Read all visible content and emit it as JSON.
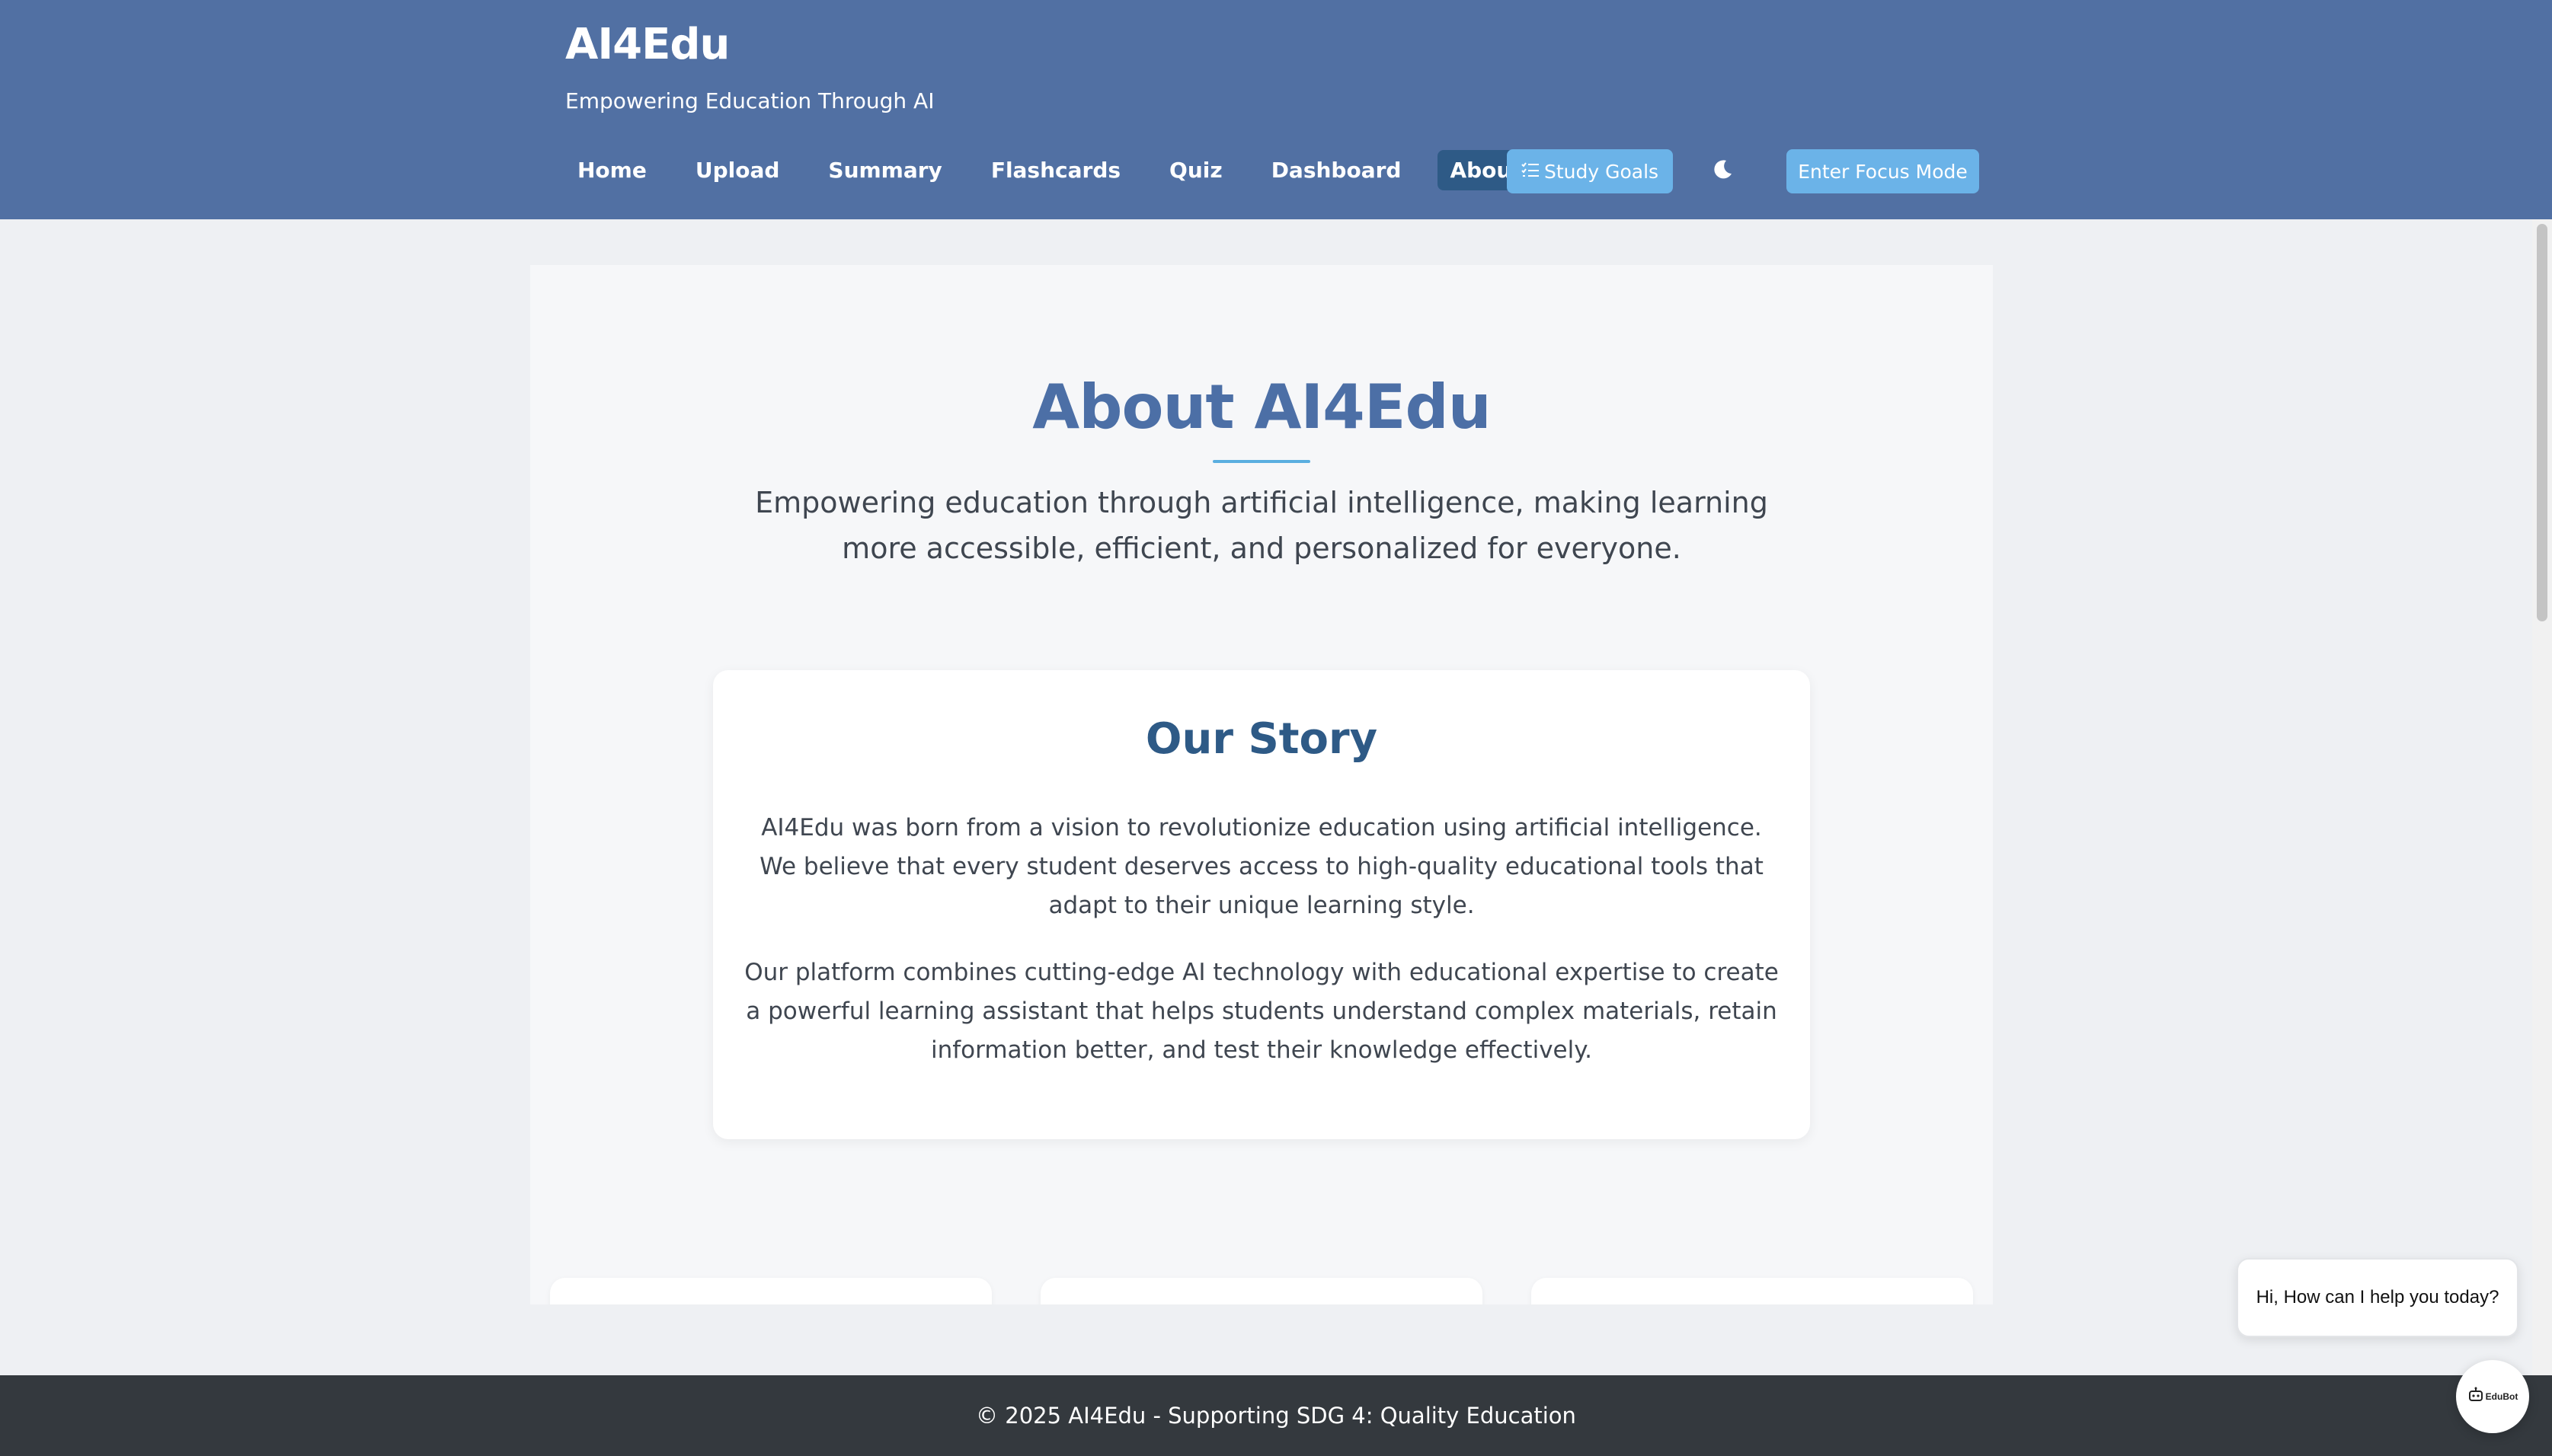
{
  "header": {
    "brand": "AI4Edu",
    "tagline": "Empowering Education Through AI",
    "nav": [
      {
        "label": "Home",
        "active": false
      },
      {
        "label": "Upload",
        "active": false
      },
      {
        "label": "Summary",
        "active": false
      },
      {
        "label": "Flashcards",
        "active": false
      },
      {
        "label": "Quiz",
        "active": false
      },
      {
        "label": "Dashboard",
        "active": false
      },
      {
        "label": "About",
        "active": true
      }
    ],
    "study_goals_label": "Study Goals",
    "theme_icon": "moon-icon",
    "focus_mode_label": "Enter Focus Mode"
  },
  "about": {
    "title": "About AI4Edu",
    "subtitle": "Empowering education through artificial intelligence, making learning more accessible, efficient, and personalized for everyone."
  },
  "story": {
    "title": "Our Story",
    "paragraphs": [
      "AI4Edu was born from a vision to revolutionize education using artificial intelligence. We believe that every student deserves access to high-quality educational tools that adapt to their unique learning style.",
      "Our platform combines cutting-edge AI technology with educational expertise to create a powerful learning assistant that helps students understand complex materials, retain information better, and test their knowledge effectively."
    ]
  },
  "footer": {
    "text": "© 2025 AI4Edu - Supporting SDG 4: Quality Education"
  },
  "chat": {
    "greeting": "Hi, How can I help you today?",
    "bot_label": "EduBot"
  },
  "colors": {
    "header_bg": "#5170a3",
    "active_nav": "#2e5a86",
    "accent_button": "#6bb3e8",
    "footer_bg": "#34393e"
  }
}
